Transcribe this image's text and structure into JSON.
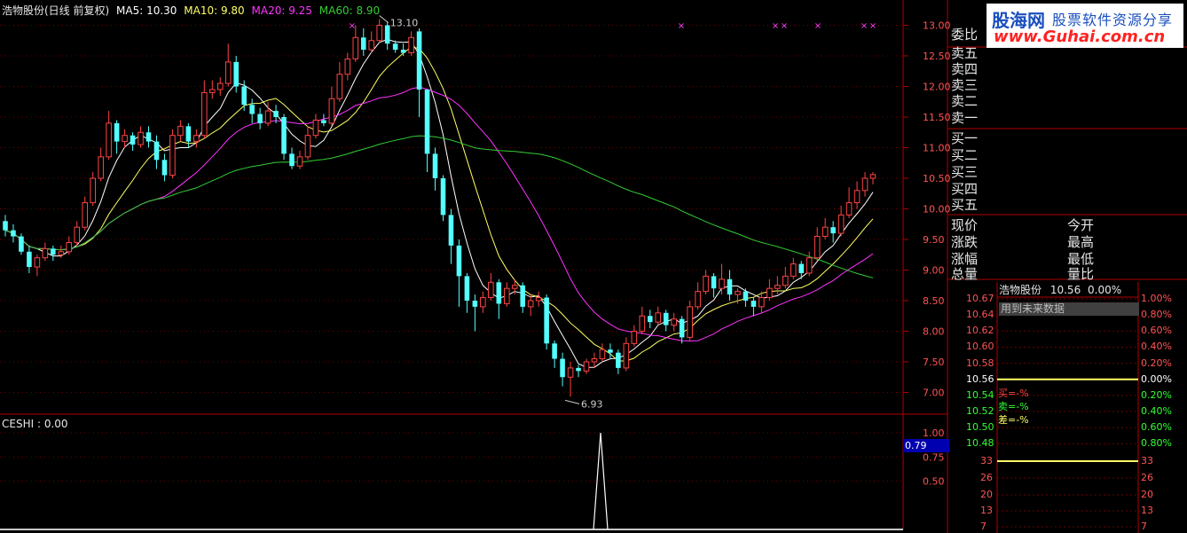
{
  "header": {
    "stock_title": "浩物股份(日线 前复权)",
    "ma5_label": "MA5: 10.30",
    "ma10_label": "MA10: 9.80",
    "ma20_label": "MA20: 9.25",
    "ma60_label": "MA60: 8.90"
  },
  "colors": {
    "ma5": "#ffffff",
    "ma10": "#ffff66",
    "ma20": "#ff33ff",
    "ma60": "#33cc33",
    "up": "#ff4444",
    "down": "#54ffff",
    "axis": "#b00000",
    "price_text": "#ff5555"
  },
  "main_chart": {
    "y_ticks": [
      "13.00",
      "12.50",
      "12.00",
      "11.50",
      "11.00",
      "10.50",
      "10.00",
      "9.50",
      "9.00",
      "8.50",
      "8.00",
      "7.50",
      "7.00"
    ],
    "high_label": "13.10",
    "low_label": "6.93",
    "markers": [
      "×",
      "×",
      "×",
      "×",
      "×",
      "×",
      "×"
    ]
  },
  "indicator": {
    "label": "CESHI : 0.00",
    "y_ticks": [
      "1.00",
      "0.75",
      "0.50"
    ],
    "cursor_value": "0.79"
  },
  "sidebar": {
    "order_book": [
      "委比",
      "卖五",
      "卖四",
      "卖三",
      "卖二",
      "卖一",
      "买一",
      "买二",
      "买三",
      "买四",
      "买五"
    ],
    "stats_left": [
      "现价",
      "涨跌",
      "涨幅",
      "总量"
    ],
    "stats_right": [
      "今开",
      "最高",
      "最低",
      "量比"
    ]
  },
  "logo": {
    "brand": "股海网",
    "slogan": "股票软件资源分享",
    "url": "www.Guhai.com.cn"
  },
  "minute_chart": {
    "title": "浩物股份",
    "price": "10.56",
    "change": "0.00%",
    "future_text": "用到未来数据",
    "left_prices": [
      "10.67",
      "10.64",
      "10.62",
      "10.60",
      "10.58",
      "10.56",
      "10.54",
      "10.52",
      "10.50",
      "10.48"
    ],
    "right_pcts": [
      "1.00%",
      "0.80%",
      "0.60%",
      "0.40%",
      "0.20%",
      "0.00%",
      "0.20%",
      "0.40%",
      "0.60%",
      "0.80%"
    ],
    "buy_label": "买=-%",
    "sell_label": "卖=-%",
    "diff_label": "差=-%",
    "volume_ticks": [
      "33",
      "26",
      "20",
      "13",
      "7"
    ]
  },
  "chart_data": {
    "type": "candlestick",
    "ylim": [
      6.9,
      13.2
    ],
    "series_names": [
      "MA5",
      "MA10",
      "MA20",
      "MA60"
    ],
    "candles": [
      [
        9.8,
        9.65,
        9.9,
        9.55
      ],
      [
        9.65,
        9.55,
        9.75,
        9.45
      ],
      [
        9.55,
        9.3,
        9.6,
        9.25
      ],
      [
        9.3,
        9.05,
        9.4,
        8.95
      ],
      [
        9.05,
        9.2,
        9.25,
        8.9
      ],
      [
        9.2,
        9.35,
        9.45,
        9.15
      ],
      [
        9.35,
        9.25,
        9.4,
        9.15
      ],
      [
        9.25,
        9.3,
        9.4,
        9.2
      ],
      [
        9.3,
        9.45,
        9.55,
        9.25
      ],
      [
        9.45,
        9.7,
        9.8,
        9.4
      ],
      [
        9.7,
        10.1,
        10.2,
        9.65
      ],
      [
        10.1,
        10.5,
        10.6,
        10.05
      ],
      [
        10.5,
        10.85,
        11.0,
        10.45
      ],
      [
        10.85,
        11.4,
        11.6,
        10.8
      ],
      [
        11.4,
        11.1,
        11.45,
        10.9
      ],
      [
        11.1,
        11.2,
        11.3,
        11.0
      ],
      [
        11.2,
        11.05,
        11.25,
        10.95
      ],
      [
        11.05,
        11.25,
        11.35,
        11.0
      ],
      [
        11.25,
        11.1,
        11.35,
        11.0
      ],
      [
        11.1,
        10.8,
        11.2,
        10.65
      ],
      [
        10.8,
        10.55,
        10.9,
        10.45
      ],
      [
        10.55,
        11.2,
        11.3,
        10.5
      ],
      [
        11.2,
        11.35,
        11.45,
        11.1
      ],
      [
        11.35,
        11.1,
        11.4,
        11.0
      ],
      [
        11.1,
        11.2,
        11.3,
        11.0
      ],
      [
        11.2,
        11.9,
        12.1,
        11.15
      ],
      [
        11.9,
        11.95,
        12.1,
        11.8
      ],
      [
        11.95,
        12.05,
        12.15,
        11.85
      ],
      [
        12.05,
        12.4,
        12.7,
        12.0
      ],
      [
        12.4,
        12.0,
        12.5,
        11.9
      ],
      [
        12.0,
        11.7,
        12.1,
        11.6
      ],
      [
        11.7,
        11.55,
        11.8,
        11.4
      ],
      [
        11.55,
        11.4,
        11.65,
        11.3
      ],
      [
        11.4,
        11.6,
        11.75,
        11.35
      ],
      [
        11.6,
        11.5,
        11.7,
        11.4
      ],
      [
        11.5,
        10.9,
        11.55,
        10.8
      ],
      [
        10.9,
        10.7,
        11.0,
        10.65
      ],
      [
        10.7,
        10.85,
        10.95,
        10.65
      ],
      [
        10.85,
        11.2,
        11.35,
        10.8
      ],
      [
        11.2,
        11.45,
        11.55,
        11.15
      ],
      [
        11.45,
        11.4,
        11.55,
        11.35
      ],
      [
        11.4,
        11.8,
        12.0,
        11.35
      ],
      [
        11.8,
        12.2,
        12.4,
        11.75
      ],
      [
        12.2,
        12.45,
        12.55,
        12.1
      ],
      [
        12.45,
        12.8,
        13.0,
        12.4
      ],
      [
        12.8,
        12.6,
        12.95,
        12.5
      ],
      [
        12.6,
        12.75,
        12.9,
        12.55
      ],
      [
        12.75,
        13.0,
        13.1,
        12.7
      ],
      [
        13.0,
        12.7,
        13.05,
        12.6
      ],
      [
        12.7,
        12.6,
        12.75,
        12.55
      ],
      [
        12.6,
        12.55,
        12.7,
        12.5
      ],
      [
        12.55,
        12.8,
        12.9,
        12.5
      ],
      [
        12.9,
        11.95,
        12.95,
        11.5
      ],
      [
        11.95,
        10.9,
        11.95,
        10.6
      ],
      [
        10.9,
        10.5,
        11.0,
        10.3
      ],
      [
        10.5,
        9.9,
        10.55,
        9.8
      ],
      [
        9.9,
        9.4,
        10.0,
        9.1
      ],
      [
        9.4,
        8.9,
        9.5,
        8.4
      ],
      [
        8.9,
        8.5,
        8.95,
        8.3
      ],
      [
        8.5,
        8.4,
        8.6,
        8.0
      ],
      [
        8.4,
        8.55,
        8.65,
        8.3
      ],
      [
        8.55,
        8.8,
        8.95,
        8.5
      ],
      [
        8.8,
        8.45,
        8.85,
        8.2
      ],
      [
        8.45,
        8.7,
        8.8,
        8.4
      ],
      [
        8.7,
        8.75,
        8.85,
        8.6
      ],
      [
        8.75,
        8.4,
        8.8,
        8.3
      ],
      [
        8.4,
        8.5,
        8.6,
        8.25
      ],
      [
        8.5,
        8.55,
        8.65,
        8.4
      ],
      [
        8.55,
        7.8,
        8.6,
        7.7
      ],
      [
        7.8,
        7.55,
        7.85,
        7.4
      ],
      [
        7.55,
        7.25,
        7.65,
        7.1
      ],
      [
        7.25,
        7.4,
        7.5,
        6.93
      ],
      [
        7.4,
        7.35,
        7.45,
        7.25
      ],
      [
        7.35,
        7.5,
        7.55,
        7.3
      ],
      [
        7.5,
        7.55,
        7.65,
        7.4
      ],
      [
        7.55,
        7.7,
        7.8,
        7.5
      ],
      [
        7.7,
        7.65,
        7.8,
        7.55
      ],
      [
        7.65,
        7.4,
        7.7,
        7.3
      ],
      [
        7.4,
        7.8,
        7.9,
        7.35
      ],
      [
        7.8,
        8.0,
        8.1,
        7.75
      ],
      [
        8.0,
        8.25,
        8.4,
        7.95
      ],
      [
        8.25,
        8.15,
        8.35,
        8.05
      ],
      [
        8.15,
        8.3,
        8.4,
        8.1
      ],
      [
        8.3,
        8.1,
        8.35,
        8.0
      ],
      [
        8.1,
        8.2,
        8.3,
        8.0
      ],
      [
        8.2,
        7.9,
        8.25,
        7.8
      ],
      [
        7.9,
        8.4,
        8.5,
        7.85
      ],
      [
        8.4,
        8.65,
        8.8,
        8.35
      ],
      [
        8.65,
        8.9,
        9.0,
        8.6
      ],
      [
        8.9,
        8.7,
        8.95,
        8.55
      ],
      [
        8.7,
        8.85,
        9.1,
        8.6
      ],
      [
        8.85,
        8.6,
        9.0,
        8.5
      ],
      [
        8.6,
        8.65,
        8.7,
        8.45
      ],
      [
        8.65,
        8.5,
        8.7,
        8.4
      ],
      [
        8.5,
        8.4,
        8.55,
        8.25
      ],
      [
        8.4,
        8.55,
        8.65,
        8.3
      ],
      [
        8.55,
        8.7,
        8.85,
        8.5
      ],
      [
        8.7,
        8.75,
        8.9,
        8.6
      ],
      [
        8.75,
        8.9,
        9.05,
        8.7
      ],
      [
        8.9,
        9.1,
        9.2,
        8.85
      ],
      [
        9.1,
        8.95,
        9.15,
        8.85
      ],
      [
        8.95,
        9.2,
        9.3,
        8.9
      ],
      [
        9.2,
        9.55,
        9.7,
        9.15
      ],
      [
        9.55,
        9.7,
        9.85,
        9.5
      ],
      [
        9.7,
        9.6,
        9.8,
        9.45
      ],
      [
        9.6,
        9.9,
        10.05,
        9.55
      ],
      [
        9.9,
        10.1,
        10.35,
        9.85
      ],
      [
        10.1,
        10.3,
        10.45,
        10.0
      ],
      [
        10.3,
        10.5,
        10.6,
        10.2
      ],
      [
        10.5,
        10.56,
        10.6,
        10.4
      ]
    ]
  }
}
